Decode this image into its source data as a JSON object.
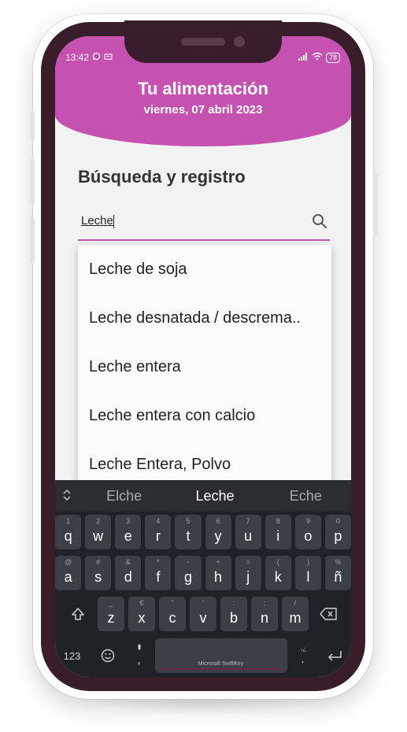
{
  "status_bar": {
    "time": "13:42",
    "battery": "78"
  },
  "header": {
    "title": "Tu alimentación",
    "date": "viernes, 07 abril 2023"
  },
  "section": {
    "title": "Búsqueda y registro"
  },
  "search": {
    "value": "Leche"
  },
  "suggestions": [
    "Leche de soja",
    "Leche desnatada / descrema..",
    "Leche entera",
    "Leche entera con calcio",
    "Leche Entera, Polvo"
  ],
  "keyboard": {
    "word_suggestions": [
      "Elche",
      "Leche",
      "Eche"
    ],
    "row1": [
      {
        "k": "q",
        "a": "1"
      },
      {
        "k": "w",
        "a": "2"
      },
      {
        "k": "e",
        "a": "3"
      },
      {
        "k": "r",
        "a": "4"
      },
      {
        "k": "t",
        "a": "5"
      },
      {
        "k": "y",
        "a": "6"
      },
      {
        "k": "u",
        "a": "7"
      },
      {
        "k": "i",
        "a": "8"
      },
      {
        "k": "o",
        "a": "9"
      },
      {
        "k": "p",
        "a": "0"
      }
    ],
    "row2": [
      {
        "k": "a",
        "a": "@"
      },
      {
        "k": "s",
        "a": "#"
      },
      {
        "k": "d",
        "a": "&"
      },
      {
        "k": "f",
        "a": "*"
      },
      {
        "k": "g",
        "a": "-"
      },
      {
        "k": "h",
        "a": "+"
      },
      {
        "k": "j",
        "a": "="
      },
      {
        "k": "k",
        "a": "("
      },
      {
        "k": "l",
        "a": ")"
      },
      {
        "k": "ñ",
        "a": "%"
      }
    ],
    "row3": [
      {
        "k": "z",
        "a": "_"
      },
      {
        "k": "x",
        "a": "€"
      },
      {
        "k": "c",
        "a": "\""
      },
      {
        "k": "v",
        "a": "'"
      },
      {
        "k": "b",
        "a": ":"
      },
      {
        "k": "n",
        "a": ";"
      },
      {
        "k": "m",
        "a": "/"
      }
    ],
    "numbers_label": "123",
    "comma": ",",
    "period": ".",
    "period_alt": ".¡¿",
    "space_label": "Microsoft SwiftKey"
  },
  "colors": {
    "accent": "#c552b0",
    "phone_frame": "#3a1d2b",
    "keyboard_bg": "#1f2327"
  }
}
